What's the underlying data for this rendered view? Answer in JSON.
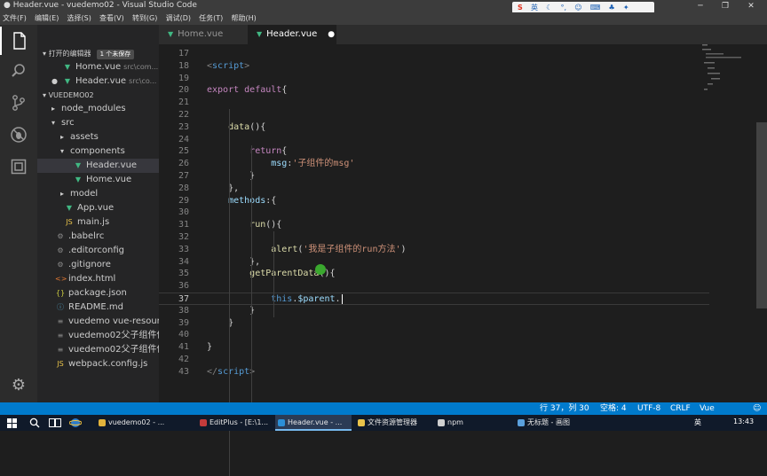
{
  "window": {
    "title": "● Header.vue - vuedemo02 - Visual Studio Code",
    "controls": [
      "─",
      "❐",
      "✕"
    ]
  },
  "menu": [
    "文件(F)",
    "编辑(E)",
    "选择(S)",
    "查看(V)",
    "转到(G)",
    "调试(D)",
    "任务(T)",
    "帮助(H)"
  ],
  "ime": {
    "label": "英"
  },
  "activity_bar": {
    "icons": [
      "files-icon",
      "search-icon",
      "source-control-icon",
      "debug-icon",
      "extensions-icon",
      "settings-icon"
    ]
  },
  "sidebar": {
    "open_editors": {
      "label": "打开的编辑器",
      "badge": "1 个未保存",
      "items": [
        {
          "name": "Home.vue",
          "path": "src\\com..."
        },
        {
          "name": "Header.vue",
          "path": "src\\co..."
        }
      ]
    },
    "project": {
      "label": "VUEDEMO02"
    },
    "tree": [
      {
        "label": "node_modules",
        "type": "folder",
        "depth": 1,
        "open": false
      },
      {
        "label": "src",
        "type": "folder",
        "depth": 1,
        "open": true
      },
      {
        "label": "assets",
        "type": "folder",
        "depth": 2,
        "open": false
      },
      {
        "label": "components",
        "type": "folder",
        "depth": 2,
        "open": true
      },
      {
        "label": "Header.vue",
        "type": "vue",
        "depth": 3,
        "selected": true
      },
      {
        "label": "Home.vue",
        "type": "vue",
        "depth": 3
      },
      {
        "label": "model",
        "type": "folder",
        "depth": 2,
        "open": false
      },
      {
        "label": "App.vue",
        "type": "vue",
        "depth": 2
      },
      {
        "label": "main.js",
        "type": "js",
        "depth": 2
      },
      {
        "label": ".babelrc",
        "type": "config",
        "depth": 1
      },
      {
        "label": ".editorconfig",
        "type": "config",
        "depth": 1
      },
      {
        "label": ".gitignore",
        "type": "config",
        "depth": 1
      },
      {
        "label": "index.html",
        "type": "html",
        "depth": 1
      },
      {
        "label": "package.json",
        "type": "json",
        "depth": 1
      },
      {
        "label": "README.md",
        "type": "md",
        "depth": 1
      },
      {
        "label": "vuedemo vue-resourc...",
        "type": "doc",
        "depth": 1
      },
      {
        "label": "vuedemo02父子组件传...",
        "type": "doc",
        "depth": 1
      },
      {
        "label": "vuedemo02父子组件传...",
        "type": "doc",
        "depth": 1
      },
      {
        "label": "webpack.config.js",
        "type": "js",
        "depth": 1
      }
    ]
  },
  "tabs": [
    {
      "label": "Home.vue",
      "active": false
    },
    {
      "label": "Header.vue",
      "active": true,
      "modified": "●"
    }
  ],
  "editor": {
    "lines": [
      {
        "n": "17",
        "tokens": []
      },
      {
        "n": "18",
        "tokens": [
          [
            "tag",
            "<"
          ],
          [
            "tagname",
            "script"
          ],
          [
            "tag",
            ">"
          ]
        ]
      },
      {
        "n": "19",
        "tokens": []
      },
      {
        "n": "20",
        "tokens": [
          [
            "kw",
            "export "
          ],
          [
            "kw",
            "default"
          ],
          [
            "plain",
            "{"
          ]
        ]
      },
      {
        "n": "21",
        "tokens": []
      },
      {
        "n": "22",
        "tokens": []
      },
      {
        "n": "23",
        "tokens": [
          [
            "plain",
            "    "
          ],
          [
            "fn",
            "data"
          ],
          [
            "plain",
            "(){"
          ]
        ]
      },
      {
        "n": "24",
        "tokens": []
      },
      {
        "n": "25",
        "tokens": [
          [
            "plain",
            "        "
          ],
          [
            "kw",
            "return"
          ],
          [
            "plain",
            "{"
          ]
        ]
      },
      {
        "n": "26",
        "tokens": [
          [
            "plain",
            "            "
          ],
          [
            "prop",
            "msg"
          ],
          [
            "plain",
            ":"
          ],
          [
            "str",
            "'子组件的msg'"
          ]
        ]
      },
      {
        "n": "27",
        "tokens": [
          [
            "plain",
            "        }"
          ]
        ]
      },
      {
        "n": "28",
        "tokens": [
          [
            "plain",
            "    },"
          ]
        ]
      },
      {
        "n": "29",
        "tokens": [
          [
            "plain",
            "    "
          ],
          [
            "prop",
            "methods"
          ],
          [
            "plain",
            ":{"
          ]
        ]
      },
      {
        "n": "30",
        "tokens": []
      },
      {
        "n": "31",
        "tokens": [
          [
            "plain",
            "        "
          ],
          [
            "fn",
            "run"
          ],
          [
            "plain",
            "(){"
          ]
        ]
      },
      {
        "n": "32",
        "tokens": []
      },
      {
        "n": "33",
        "tokens": [
          [
            "plain",
            "            "
          ],
          [
            "fn",
            "alert"
          ],
          [
            "plain",
            "("
          ],
          [
            "str",
            "'我是子组件的run方法'"
          ],
          [
            "plain",
            ")"
          ]
        ]
      },
      {
        "n": "34",
        "tokens": [
          [
            "plain",
            "        },"
          ]
        ]
      },
      {
        "n": "35",
        "tokens": [
          [
            "plain",
            "        "
          ],
          [
            "fn",
            "getParentData"
          ],
          [
            "plain",
            "(){"
          ]
        ]
      },
      {
        "n": "36",
        "tokens": []
      },
      {
        "n": "37",
        "tokens": [
          [
            "plain",
            "            "
          ],
          [
            "this",
            "this"
          ],
          [
            "plain",
            "."
          ],
          [
            "prop",
            "$parent"
          ],
          [
            "plain",
            "."
          ]
        ]
      },
      {
        "n": "38",
        "tokens": [
          [
            "plain",
            "        }"
          ]
        ]
      },
      {
        "n": "39",
        "tokens": [
          [
            "plain",
            "    }"
          ]
        ]
      },
      {
        "n": "40",
        "tokens": []
      },
      {
        "n": "41",
        "tokens": [
          [
            "plain",
            "}"
          ]
        ]
      },
      {
        "n": "42",
        "tokens": []
      },
      {
        "n": "43",
        "tokens": [
          [
            "tag",
            "</"
          ],
          [
            "tagname",
            "script"
          ],
          [
            "tag",
            ">"
          ]
        ]
      }
    ],
    "current_line": "37"
  },
  "status": {
    "position": "行 37，列 30",
    "spaces": "空格: 4",
    "encoding": "UTF-8",
    "eol": "CRLF",
    "language": "Vue",
    "smiley": "☺"
  },
  "taskbar": {
    "items": [
      {
        "label": "vuedemo02 - ...",
        "color": "#e2b33c"
      },
      {
        "label": "EditPlus - [E:\\1...",
        "color": "#c43b3b"
      },
      {
        "label": "Header.vue - ...",
        "color": "#2c8fd6",
        "active": true
      },
      {
        "label": "文件资源管理器",
        "color": "#e8c24a"
      },
      {
        "label": "npm",
        "color": "#cfcfcf"
      },
      {
        "label": "无标题 - 画图",
        "color": "#5aa0dd"
      }
    ],
    "clock": "13:43",
    "tray_label": "英"
  },
  "colors": {
    "accent": "#007acc",
    "vue_green": "#41b883",
    "modified_dot": "#ffffff"
  }
}
